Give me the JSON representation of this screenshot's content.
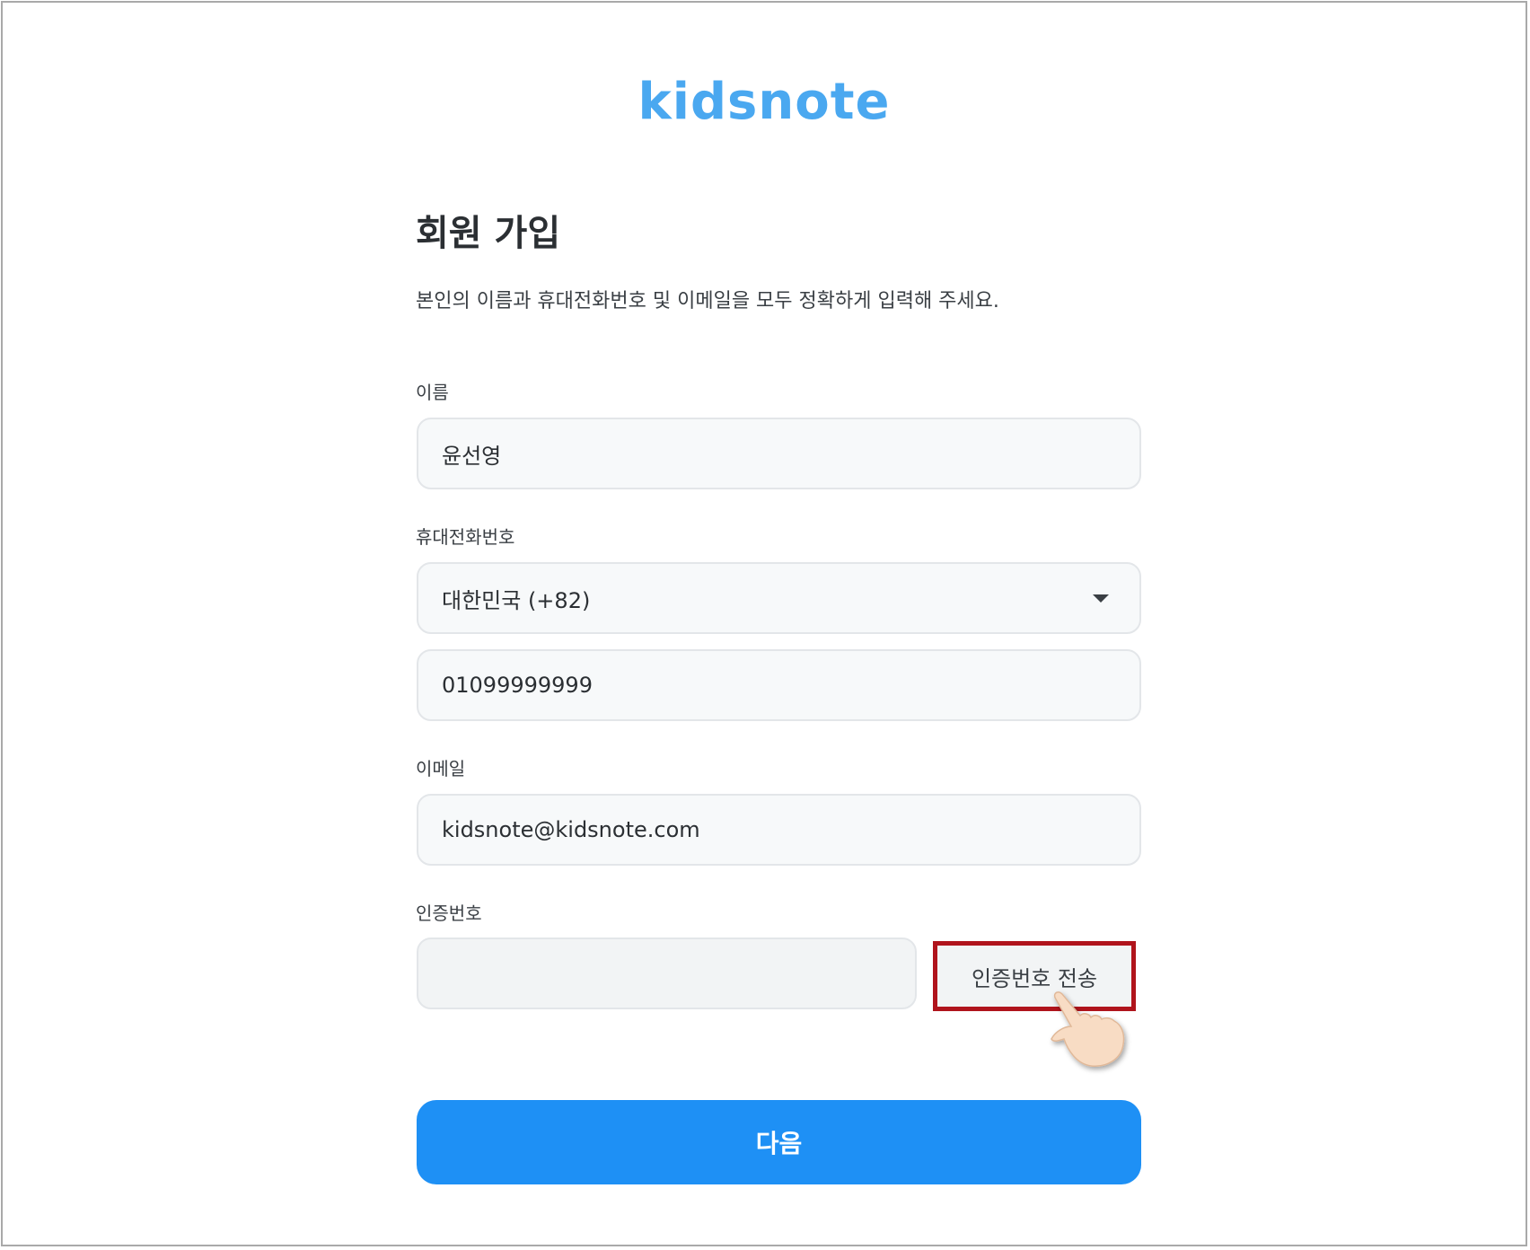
{
  "brand": {
    "logo_text": "kidsnote",
    "accent_color": "#4aa8f0",
    "primary_button_color": "#1e90f5",
    "highlight_color": "#b0141c"
  },
  "page": {
    "title": "회원 가입",
    "subtitle": "본인의 이름과 휴대전화번호 및 이메일을 모두 정확하게 입력해 주세요."
  },
  "form": {
    "name": {
      "label": "이름",
      "value": "윤선영"
    },
    "phone": {
      "label": "휴대전화번호",
      "country_selected": "대한민국 (+82)",
      "number_value": "01099999999"
    },
    "email": {
      "label": "이메일",
      "value": "kidsnote@kidsnote.com"
    },
    "verification": {
      "label": "인증번호",
      "value": "",
      "send_button_label": "인증번호 전송"
    },
    "next_button_label": "다음"
  },
  "icons": {
    "country_dropdown": "chevron-down-icon",
    "cursor": "pointing-hand-cursor-icon"
  }
}
